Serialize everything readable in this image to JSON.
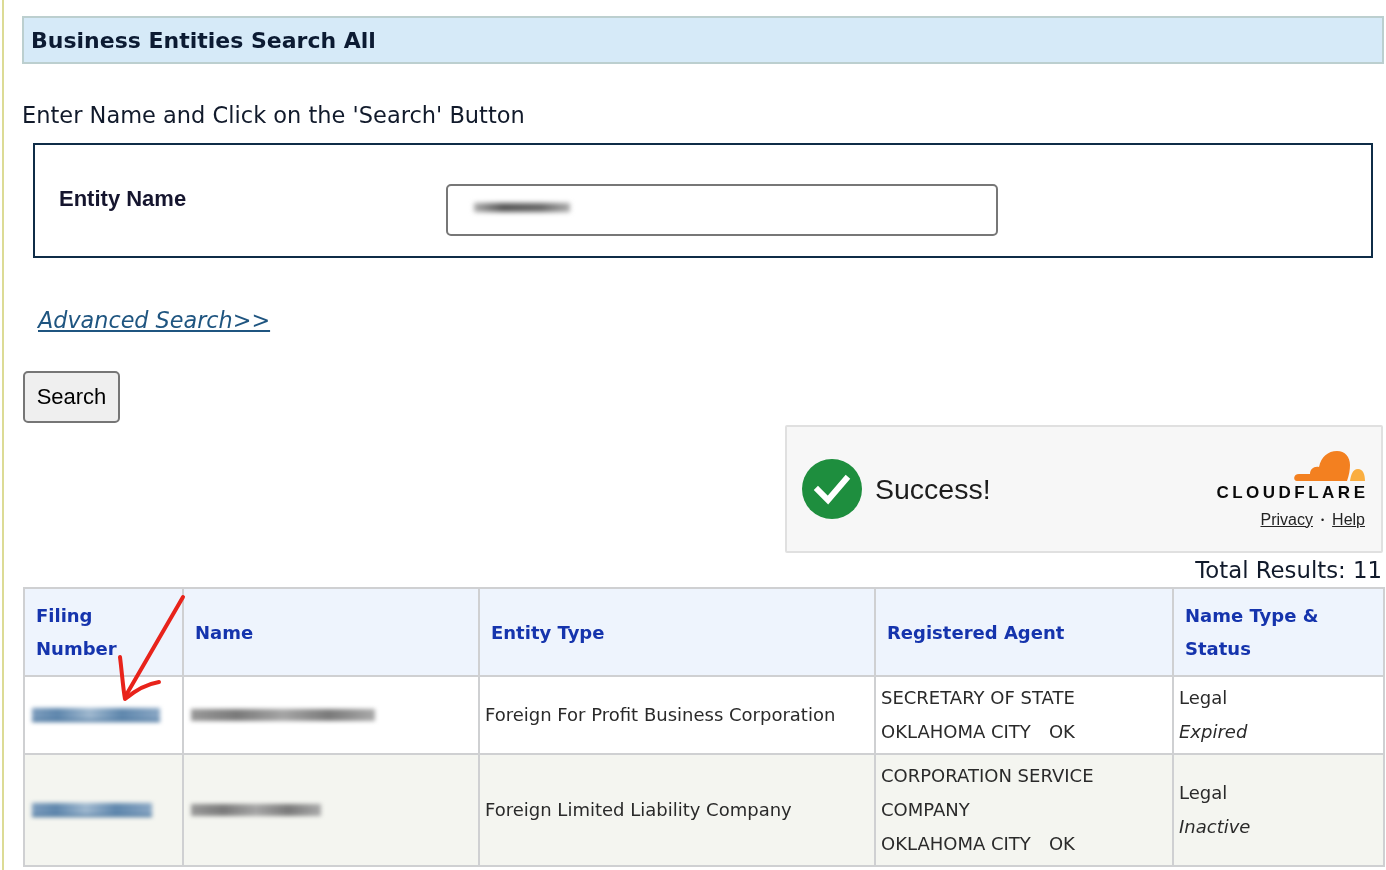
{
  "page_title": "Business Entities Search All",
  "search_form": {
    "instruction": "Enter Name and Click on the 'Search' Button",
    "field": {
      "label": "Entity Name",
      "value_blurred": true
    },
    "advanced_link": "Advanced Search>>",
    "button": "Search"
  },
  "verification": {
    "verified": true,
    "message": "Success!",
    "brand": "CLOUDFLARE",
    "links": [
      "Privacy",
      "Help"
    ],
    "separator": "•"
  },
  "results": {
    "total": "Total Results: 11",
    "columns": [
      "Filing Number",
      "Name",
      "Entity Type",
      "Registered Agent",
      "Name Type & Status"
    ],
    "rows": [
      {
        "marked_with_arrow": true,
        "filing_number_blurred": true,
        "name_blurred": true,
        "entity_type": "Foreign For Profit Business Corporation",
        "agent": {
          "name": "SECRETARY OF STATE",
          "city": "OKLAHOMA CITY",
          "state": "OK"
        },
        "name_type": "Legal",
        "status": "Expired"
      },
      {
        "marked_with_arrow": false,
        "filing_number_blurred": true,
        "name_blurred": true,
        "entity_type": "Foreign Limited Liability Company",
        "agent": {
          "name": "CORPORATION SERVICE COMPANY",
          "city": "OKLAHOMA CITY",
          "state": "OK"
        },
        "name_type": "Legal",
        "status": "Inactive"
      }
    ]
  }
}
